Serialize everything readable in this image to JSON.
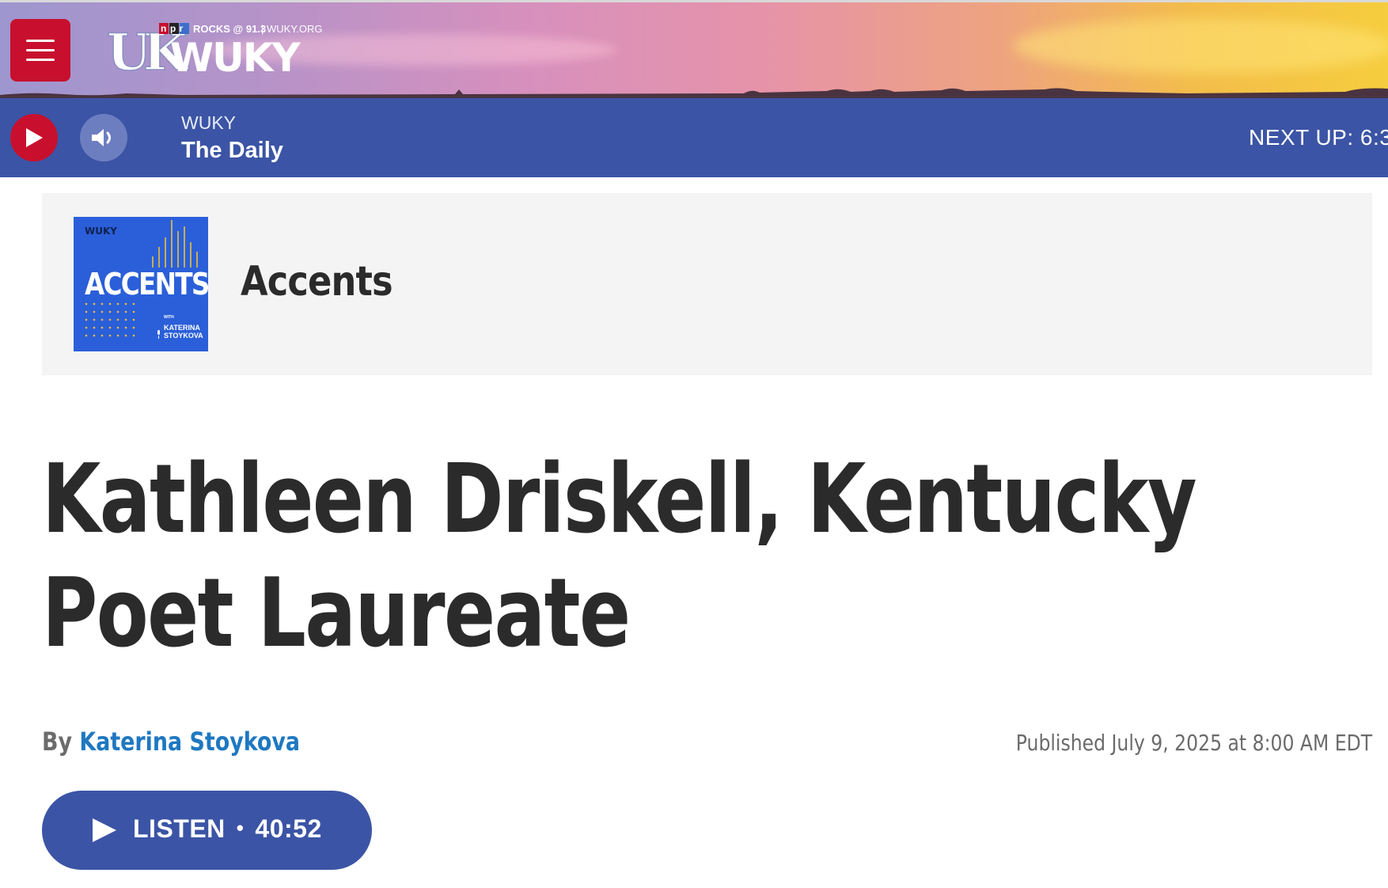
{
  "header": {
    "logo_station": "WUKY",
    "logo_tagline": "ROCKS @ 91.3",
    "logo_npr": "npr",
    "logo_url": "WUKY.ORG",
    "logo_uk": "UK"
  },
  "player": {
    "station": "WUKY",
    "program": "The Daily",
    "next_up": "NEXT UP: 6:3"
  },
  "podcast": {
    "title": "Accents",
    "art_title": "ACCENTS",
    "art_with": "WITH",
    "art_host_first": "KATERINA",
    "art_host_last": "STOYKOVA",
    "art_brand": "WUKY"
  },
  "article": {
    "headline": "Kathleen Driskell, Kentucky Poet Laureate",
    "byline_prefix": "By",
    "author": "Katerina Stoykova",
    "published": "Published July 9, 2025 at 8:00 AM EDT"
  },
  "listen": {
    "label": "LISTEN",
    "separator": "•",
    "duration": "40:52"
  },
  "colors": {
    "brand_red": "#c8102e",
    "player_blue": "#3b54a5",
    "link_blue": "#1f78c1"
  }
}
